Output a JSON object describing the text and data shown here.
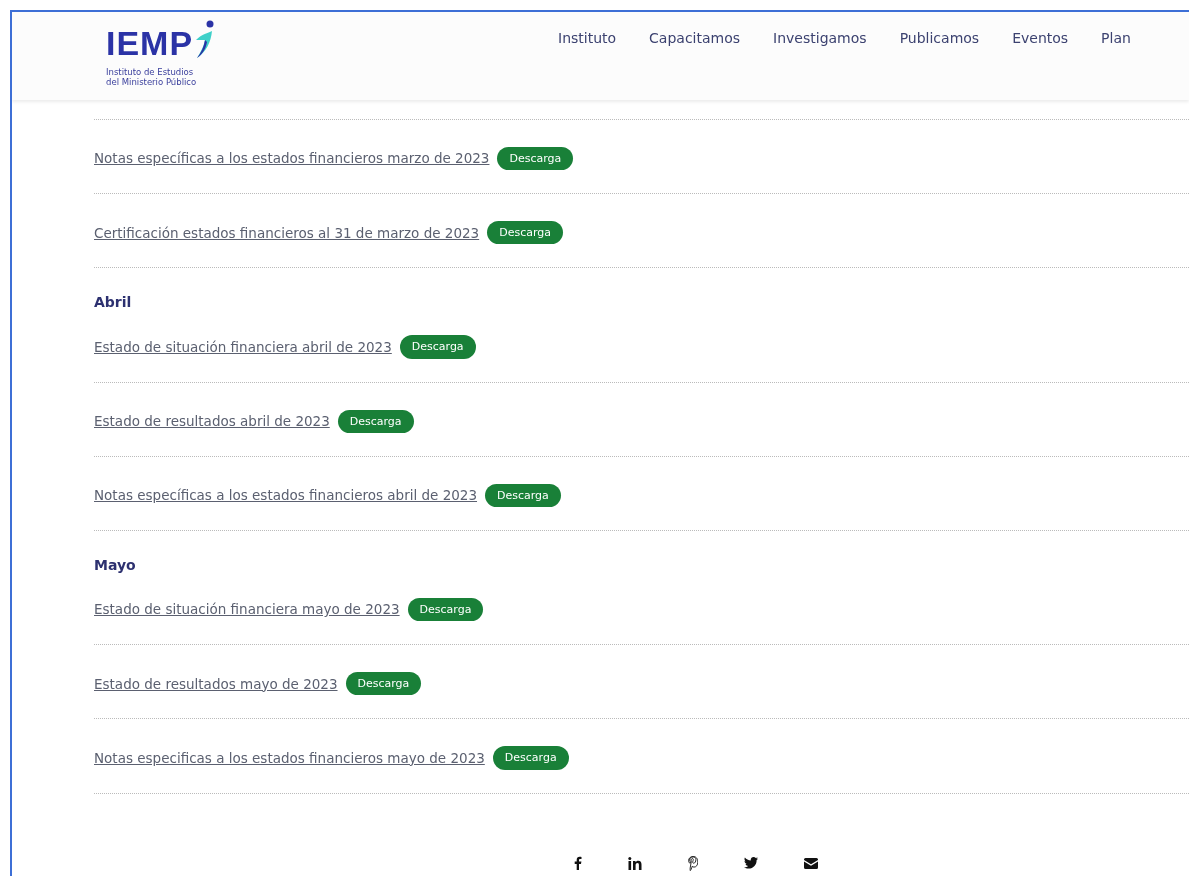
{
  "header": {
    "logo": {
      "wordmark": "IEMP",
      "subtitle": [
        "Instituto de Estudios",
        "del Ministerio Público"
      ]
    },
    "nav": [
      {
        "label": "Instituto"
      },
      {
        "label": "Capacitamos"
      },
      {
        "label": "Investigamos"
      },
      {
        "label": "Publicamos"
      },
      {
        "label": "Eventos"
      },
      {
        "label": "Plan"
      }
    ]
  },
  "sections": [
    {
      "items": [
        {
          "title": "Notas específicas a los estados financieros marzo de 2023",
          "button": "Descarga"
        },
        {
          "title": "Certificación estados financieros al 31 de marzo de 2023",
          "button": "Descarga"
        }
      ]
    },
    {
      "heading": "Abril",
      "items": [
        {
          "title": "Estado de situación financiera abril de 2023",
          "button": "Descarga"
        },
        {
          "title": "Estado de resultados abril de 2023",
          "button": "Descarga"
        },
        {
          "title": "Notas específicas a los estados financieros abril de 2023",
          "button": "Descarga"
        }
      ]
    },
    {
      "heading": "Mayo",
      "items": [
        {
          "title": "Estado de situación financiera mayo de 2023",
          "button": "Descarga"
        },
        {
          "title": "Estado de resultados mayo de 2023",
          "button": "Descarga"
        },
        {
          "title": "Notas especificas a los estados financieros mayo de 2023",
          "button": "Descarga"
        }
      ]
    }
  ]
}
